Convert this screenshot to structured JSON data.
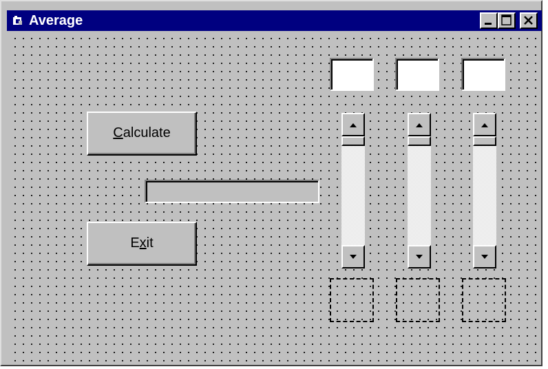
{
  "window": {
    "title": "Average",
    "icon": "form-icon",
    "controls": [
      "minimize-icon",
      "maximize-icon",
      "close-icon"
    ]
  },
  "buttons": {
    "calculate_label": "Calculate",
    "calculate_access_key": "C",
    "exit_label": "Exit",
    "exit_access_key": "x"
  },
  "result_label": {
    "text": ""
  },
  "textboxes": [
    {
      "value": ""
    },
    {
      "value": ""
    },
    {
      "value": ""
    }
  ],
  "scrollbars": [
    {
      "orientation": "vertical",
      "position": 0
    },
    {
      "orientation": "vertical",
      "position": 0
    },
    {
      "orientation": "vertical",
      "position": 0
    }
  ],
  "colors": {
    "titlebar": "#000080",
    "face": "#c0c0c0",
    "title_text": "#ffffff"
  }
}
